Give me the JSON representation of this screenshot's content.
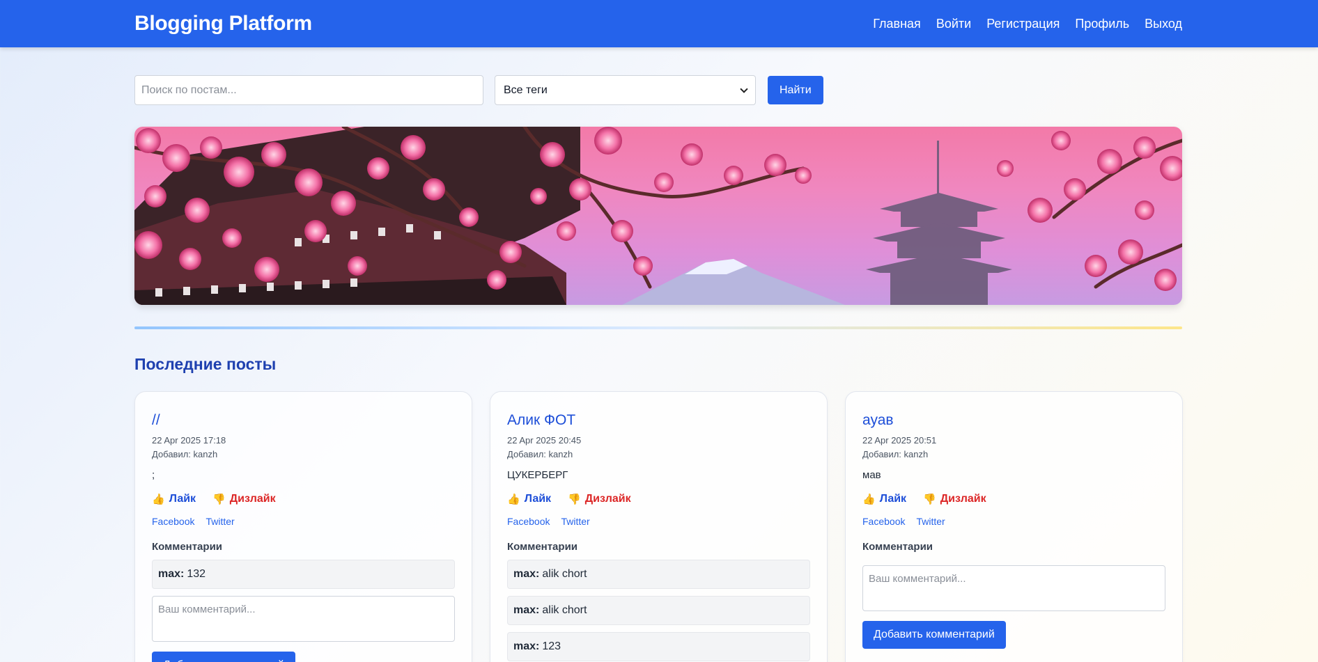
{
  "brand": "Blogging Platform",
  "nav": [
    "Главная",
    "Войти",
    "Регистрация",
    "Профиль",
    "Выход"
  ],
  "search": {
    "placeholder": "Поиск по постам...",
    "tag_selected": "Все теги",
    "button": "Найти"
  },
  "section_title": "Последние посты",
  "labels": {
    "added_by": "Добавил:",
    "like": "Лайк",
    "dislike": "Дизлайк",
    "facebook": "Facebook",
    "twitter": "Twitter",
    "comments": "Комментарии",
    "comment_placeholder": "Ваш комментарий...",
    "add_comment": "Добавить комментарий",
    "like_emoji": "👍",
    "dislike_emoji": "👎"
  },
  "posts": [
    {
      "title": "//",
      "date": "22 Apr 2025 17:18",
      "author": "Добавил: kanzh",
      "body": ";",
      "comments": [
        {
          "user": "max:",
          "text": "132"
        }
      ]
    },
    {
      "title": "Алик ФОТ",
      "date": "22 Apr 2025 20:45",
      "author": "Добавил: kanzh",
      "body": "ЦУКЕРБЕРГ",
      "comments": [
        {
          "user": "max:",
          "text": "alik chort"
        },
        {
          "user": "max:",
          "text": "alik chort"
        },
        {
          "user": "max:",
          "text": "123"
        }
      ]
    },
    {
      "title": "ауав",
      "date": "22 Apr 2025 20:51",
      "author": "Добавил: kanzh",
      "body": "мав",
      "comments": []
    }
  ]
}
